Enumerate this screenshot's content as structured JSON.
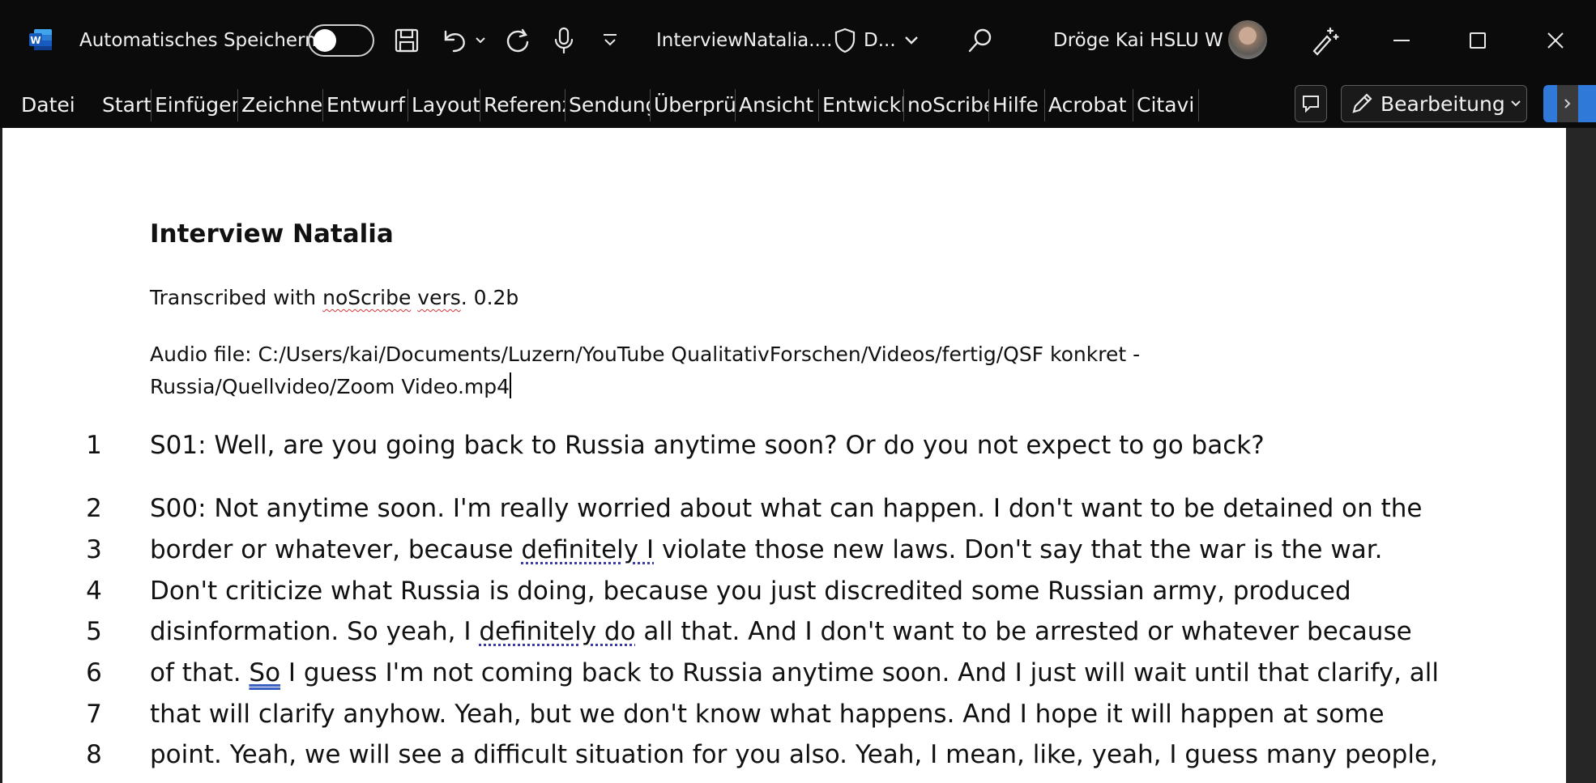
{
  "titlebar": {
    "autosave_label": "Automatisches Speichern",
    "autosave_on": false,
    "doc_title": "InterviewNatalia....",
    "sensitivity_label": "D...",
    "user_name": "Dröge Kai HSLU W"
  },
  "ribbon": {
    "tabs": [
      "Datei",
      "Start",
      "Einfügen",
      "Zeichnen",
      "Entwurf",
      "Layout",
      "Referenzen",
      "Sendungen",
      "Überprüfen",
      "Ansicht",
      "Entwicklertools",
      "noScribe",
      "Hilfe",
      "Acrobat",
      "Citavi"
    ],
    "editing_label": "Bearbeitung"
  },
  "document": {
    "heading": "Interview Natalia",
    "transcribed_prefix": "Transcribed with ",
    "transcribed_app": "noScribe",
    "transcribed_vers": "vers",
    "transcribed_suffix": ". 0.2b",
    "audio_line1": "Audio file: C:/Users/kai/Documents/Luzern/YouTube QualitativForschen/Videos/fertig/QSF konkret -",
    "audio_line2": "Russia/Quellvideo/Zoom Video.mp4",
    "lines": [
      {
        "no": "1",
        "text": "S01:  Well, are you going back to Russia anytime soon? Or do you not expect to go back?"
      },
      {
        "no": "2",
        "text": "S00:  Not anytime soon. I'm really worried about what can happen. I don't want to be detained on the"
      },
      {
        "no": "3",
        "text_a": "border or whatever, because ",
        "mark": "definitely I",
        "text_b": " violate those new laws. Don't say that the war is the war."
      },
      {
        "no": "4",
        "text": "Don't criticize what Russia is doing, because you just discredited some Russian army, produced"
      },
      {
        "no": "5",
        "text_a": "disinformation. So yeah, I ",
        "mark": "definitely do",
        "text_b": " all that. And I don't want to be arrested or whatever because"
      },
      {
        "no": "6",
        "text_a": "of that. ",
        "mark": "So",
        "text_b": " I guess I'm not coming back to Russia anytime soon. And I just will wait until that clarify, all"
      },
      {
        "no": "7",
        "text": "that will clarify anyhow. Yeah, but we don't know what happens. And I hope it will happen at some"
      },
      {
        "no": "8",
        "text": "point. Yeah, we will see a difficult situation for you also. Yeah, I mean, like, yeah, I guess many people,"
      }
    ]
  },
  "colors": {
    "titlebar_bg": "#0b0b0b",
    "page_bg": "#ffffff",
    "word_blue": "#185abd",
    "share_blue": "#2f7ad8",
    "spelling_red": "#d13438"
  }
}
